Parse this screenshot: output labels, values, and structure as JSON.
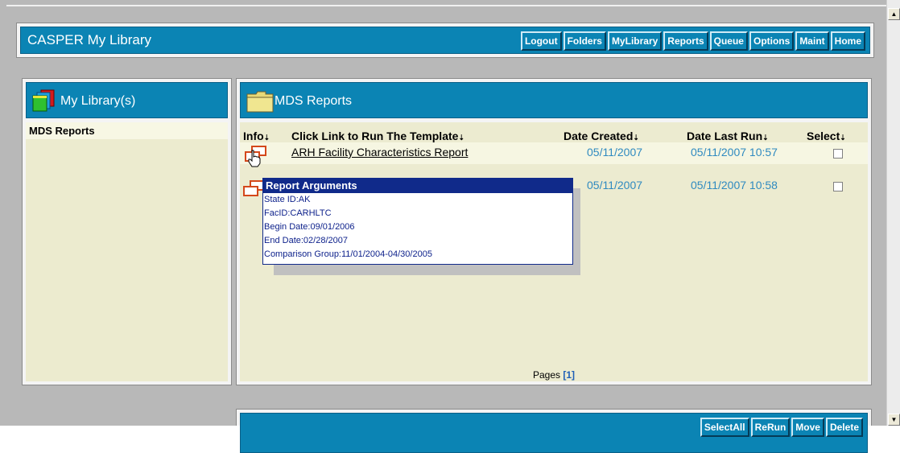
{
  "header": {
    "title": "CASPER My Library"
  },
  "nav": [
    "Logout",
    "Folders",
    "MyLibrary",
    "Reports",
    "Queue",
    "Options",
    "Maint",
    "Home"
  ],
  "left_panel": {
    "title": "My Library(s)",
    "items": [
      "MDS Reports"
    ]
  },
  "main_panel": {
    "title": "MDS Reports",
    "columns": {
      "info": "Info",
      "template": "Click Link to Run The Template",
      "created": "Date Created",
      "last_run": "Date Last Run",
      "select": "Select"
    },
    "sort_glyph": "⇣",
    "rows": [
      {
        "name": "ARH Facility Characteristics Report",
        "created": "05/11/2007",
        "last_run": "05/11/2007 10:57",
        "selected": false
      },
      {
        "name": "",
        "created": "05/11/2007",
        "last_run": "05/11/2007 10:58",
        "selected": false
      }
    ],
    "pages_label": "Pages",
    "pages_current": "[1]"
  },
  "tooltip": {
    "title": "Report Arguments",
    "lines": [
      "State ID:AK",
      "FacID:CARHLTC",
      "Begin Date:09/01/2006",
      "End Date:02/28/2007",
      "Comparison Group:11/01/2004-04/30/2005"
    ]
  },
  "footer_buttons": [
    "SelectAll",
    "ReRun",
    "Move",
    "Delete"
  ],
  "colors": {
    "bar": "#0b84b4",
    "tooltip_title": "#102a8a",
    "date_text": "#2f8ac0",
    "panel_bg": "#ecebd0"
  }
}
